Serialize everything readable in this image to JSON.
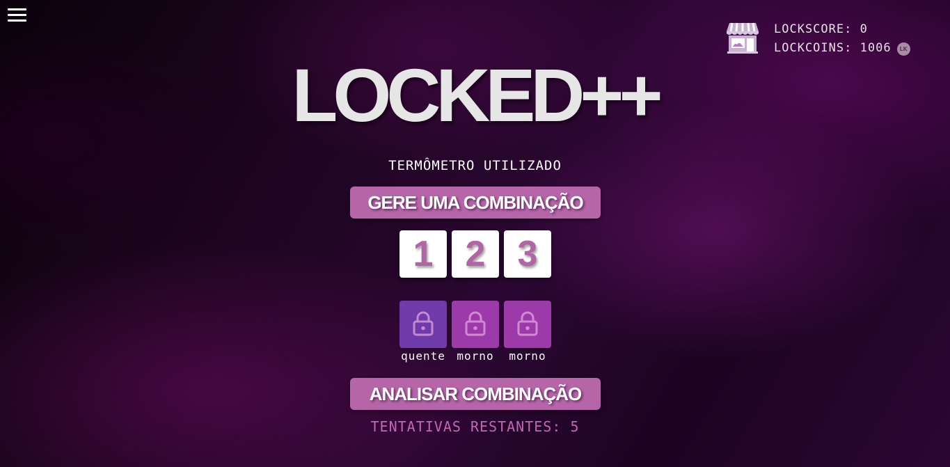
{
  "header": {
    "menu_icon": "hamburger-menu-icon",
    "store_icon": "store-icon",
    "lockscore_label": "LOCKSCORE:",
    "lockscore_value": "0",
    "lockcoins_label": "LOCKCOINS:",
    "lockcoins_value": "1006",
    "coin_badge": "LK"
  },
  "title": "LOCKED++",
  "subtitle": "TERMÔMETRO UTILIZADO",
  "generate_button": "GERE UMA COMBINAÇÃO",
  "digits": [
    "1",
    "2",
    "3"
  ],
  "locks": [
    {
      "hint": "quente",
      "color": "#6f3aaa",
      "icon": "lock-icon"
    },
    {
      "hint": "morno",
      "color": "#9d3aa9",
      "icon": "lock-icon"
    },
    {
      "hint": "morno",
      "color": "#9d3aa9",
      "icon": "lock-icon"
    }
  ],
  "analyze_button": "ANALISAR COMBINAÇÃO",
  "attempts_label": "TENTATIVAS RESTANTES:",
  "attempts_value": "5",
  "colors": {
    "accent": "#b565a8",
    "digit_text": "#b066a5",
    "attempts_text": "#c267b4"
  }
}
